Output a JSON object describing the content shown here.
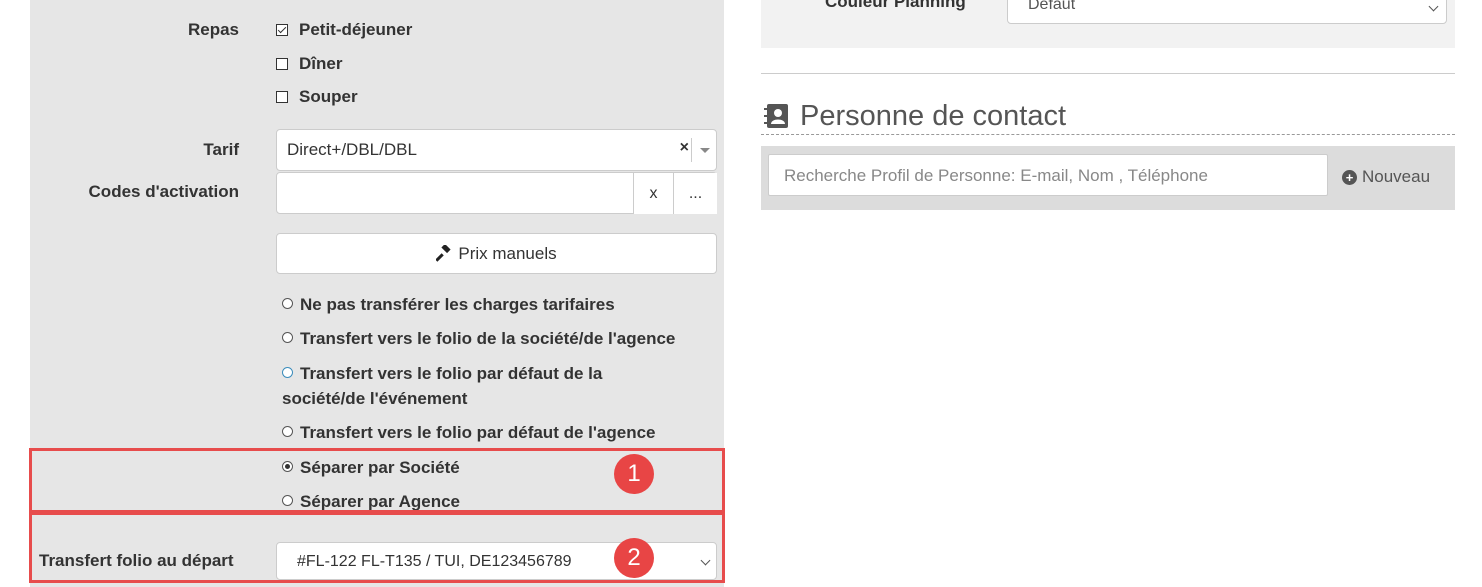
{
  "repas": {
    "label": "Repas",
    "options": [
      {
        "label": "Petit-déjeuner",
        "checked": true
      },
      {
        "label": "Dîner",
        "checked": false
      },
      {
        "label": "Souper",
        "checked": false
      }
    ]
  },
  "tarif": {
    "label": "Tarif",
    "value": "Direct+/DBL/DBL",
    "clear": "×"
  },
  "codes": {
    "label": "Codes d'activation",
    "value": "",
    "clear_btn": "x",
    "more_btn": "..."
  },
  "prix_btn": {
    "icon": "gavel-icon",
    "label": "Prix manuels"
  },
  "transfer_options": [
    {
      "label": "Ne pas transférer les charges tarifaires",
      "checked": false
    },
    {
      "label": "Transfert vers le folio de la société/de l'agence",
      "checked": false
    },
    {
      "label_line1": "Transfert vers le folio par défaut de la",
      "label_line2": "société/de l'événement",
      "checked": false
    },
    {
      "label": "Transfert vers le folio par défaut de l'agence",
      "checked": false
    },
    {
      "label": "Séparer par Société",
      "checked": true
    },
    {
      "label": "Séparer par Agence",
      "checked": false
    }
  ],
  "transfert_folio": {
    "label": "Transfert folio au départ",
    "value": "#FL-122 FL-T135 / TUI, DE123456789"
  },
  "badges": [
    "1",
    "2"
  ],
  "couleur": {
    "label": "Couleur Planning",
    "value": "Défaut"
  },
  "contact": {
    "icon": "contact-card-icon",
    "title": "Personne de contact",
    "search_placeholder": "Recherche Profil de Personne: E-mail, Nom , Téléphone",
    "new_label": "Nouveau"
  },
  "colors": {
    "highlight": "#e74c4c",
    "badge": "#e84545",
    "panel": "#e6e6e6"
  }
}
